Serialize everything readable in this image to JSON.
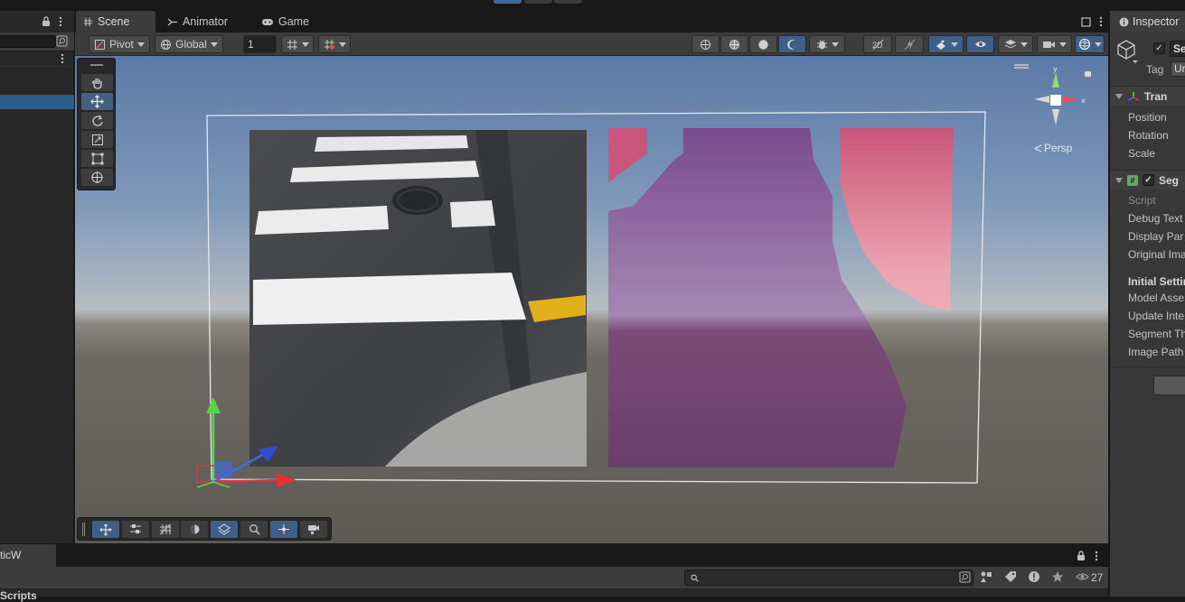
{
  "scene_tabs": {
    "scene": "Scene",
    "animator": "Animator",
    "game": "Game"
  },
  "scene_toolbar": {
    "pivot": "Pivot",
    "global": "Global",
    "grid_step": "1"
  },
  "gizmo": {
    "persp": "Persp"
  },
  "inspector": {
    "tab": "Inspector",
    "object_name": "Se",
    "tag_label": "Tag",
    "tag_value": "Ur",
    "transform": {
      "title": "Tran",
      "position": "Position",
      "rotation": "Rotation",
      "scale": "Scale"
    },
    "component": {
      "title": "Seg",
      "script": "Script",
      "debug_text": "Debug Text",
      "display_panel": "Display Par",
      "original_image": "Original Ima",
      "section": "Initial Settin",
      "model_asset": "Model Asse",
      "update_interval": "Update Inte",
      "segment_threshold": "Segment Th",
      "image_path": "Image Path"
    }
  },
  "bottom_panel": {
    "tab_label": "ticW",
    "scripts_label": "Scripts",
    "hidden_count": "27"
  },
  "colors": {
    "selection": "#2c5d87",
    "accent_blue": "#3f5f86",
    "panel": "#3c3c3c",
    "dark": "#191919"
  }
}
